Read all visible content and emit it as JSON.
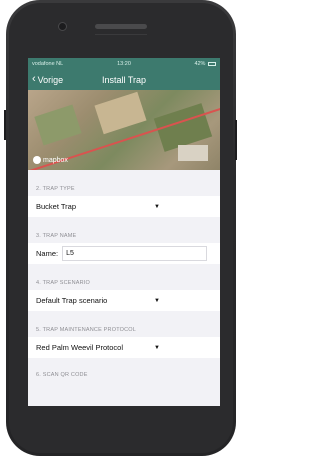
{
  "status_bar": {
    "carrier": "vodafone NL",
    "time": "13:20",
    "battery": "42%"
  },
  "navbar": {
    "back_label": "Vorige",
    "title": "Install Trap"
  },
  "map": {
    "attribution": "mapbox"
  },
  "form": {
    "trap_type": {
      "section_label": "2. TRAP TYPE",
      "value": "Bucket Trap"
    },
    "trap_name": {
      "section_label": "3. TRAP NAME",
      "field_label": "Name:",
      "value": "L5"
    },
    "trap_scenario": {
      "section_label": "4. TRAP SCENARIO",
      "value": "Default Trap scenario"
    },
    "maintenance_protocol": {
      "section_label": "5. TRAP MAINTENANCE PROTOCOL",
      "value": "Red Palm Weevil Protocol"
    },
    "scan_qr": {
      "section_label": "6. SCAN QR CODE"
    }
  },
  "colors": {
    "header": "#3d7a6e",
    "background": "#f2f2f6"
  },
  "icons": [
    "chevron-left-icon",
    "dropdown-caret-icon",
    "mapbox-logo-icon",
    "wifi-icon",
    "battery-icon"
  ]
}
